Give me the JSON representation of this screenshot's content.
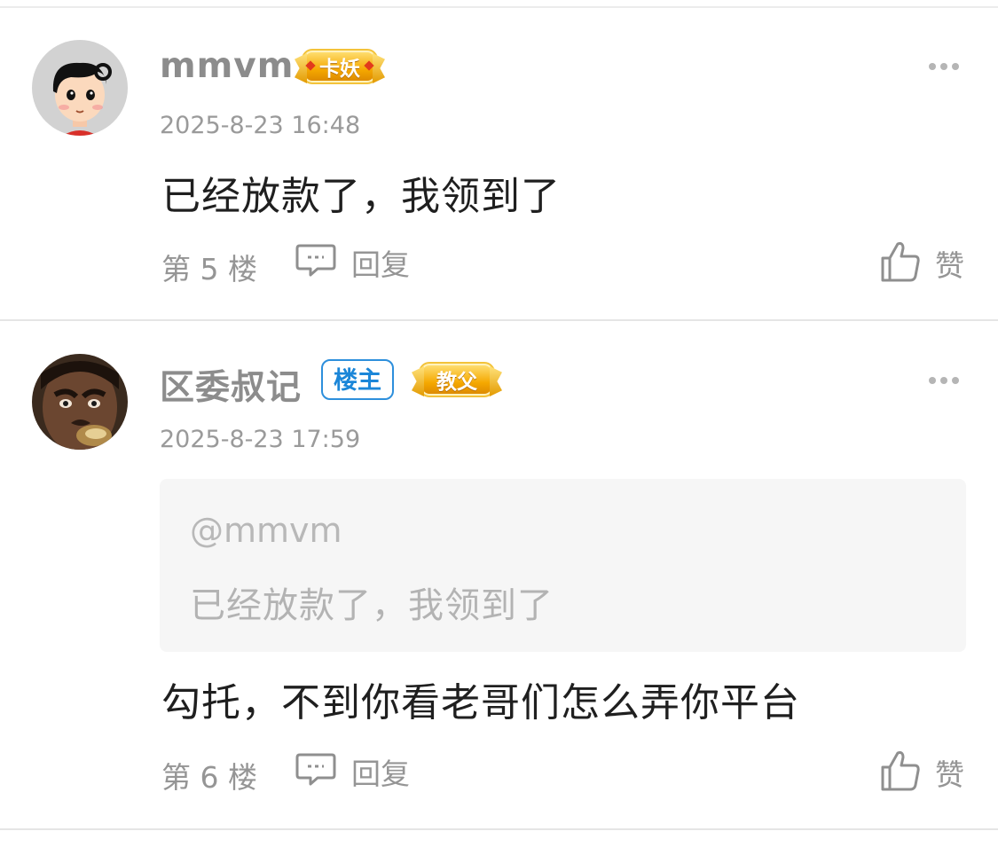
{
  "comments": [
    {
      "username": "mmvm",
      "badges": {
        "level": "卡妖"
      },
      "timestamp": "2025-8-23 16:48",
      "text": "已经放款了，我领到了",
      "floor": "第 5 楼",
      "reply_label": "回复",
      "like_label": "赞"
    },
    {
      "username": "区委叔记",
      "badges": {
        "owner": "楼主",
        "level": "教父"
      },
      "timestamp": "2025-8-23 17:59",
      "quote": {
        "user": "@mmvm",
        "text": "已经放款了，我领到了"
      },
      "text": "勾托，不到你看老哥们怎么弄你平台",
      "floor": "第 6 楼",
      "reply_label": "回复",
      "like_label": "赞"
    }
  ],
  "icons": {
    "more": "more-icon",
    "reply": "comment-bubble-icon",
    "like": "thumbs-up-icon"
  },
  "colors": {
    "owner_badge": "#2d8fdc",
    "gold_badge": "#f5a800",
    "muted_text": "#959595"
  }
}
